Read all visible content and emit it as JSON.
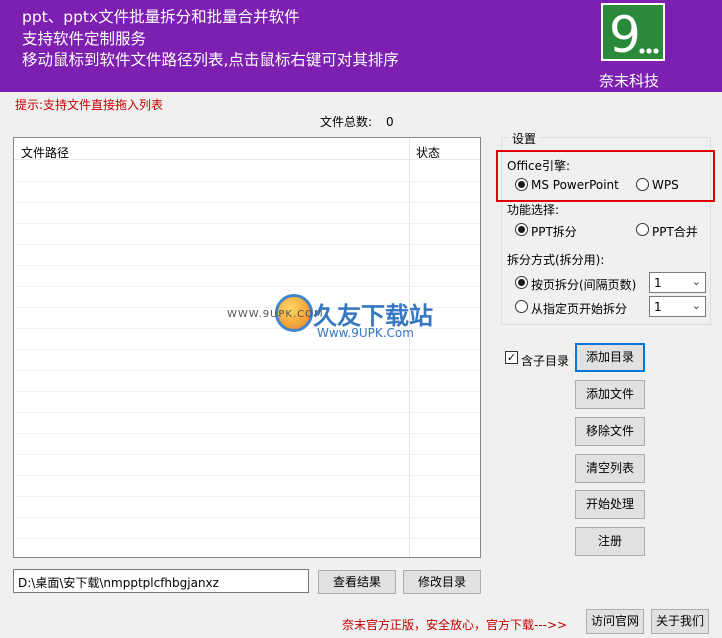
{
  "banner": {
    "lines": [
      "ppt、pptx文件批量拆分和批量合并软件",
      "支持软件定制服务",
      "移动鼠标到软件文件路径列表,点击鼠标右键可对其排序"
    ],
    "brand": "奈末科技",
    "logo_icon": "nemo-9-logo",
    "colors": {
      "banner": "#7d1fb1",
      "logo": "#2a8a3a",
      "highlight": "#e00000"
    }
  },
  "hint": "提示:支持文件直接拖入列表",
  "file_count": {
    "label": "文件总数:",
    "value": "0"
  },
  "file_list": {
    "columns": [
      "文件路径",
      "状态"
    ],
    "rows": []
  },
  "watermark": {
    "small": "WWW.9UPK.COM",
    "big": "久友下载站",
    "url": "Www.9UPK.Com"
  },
  "settings": {
    "legend": "设置",
    "engine": {
      "label": "Office引擎:",
      "options": [
        "MS PowerPoint",
        "WPS"
      ],
      "selected": "MS PowerPoint"
    },
    "function": {
      "label": "功能选择:",
      "options": [
        "PPT拆分",
        "PPT合并"
      ],
      "selected": "PPT拆分"
    },
    "split_mode": {
      "label": "拆分方式(拆分用):",
      "options": [
        {
          "label": "按页拆分(间隔页数)",
          "value": "1"
        },
        {
          "label": "从指定页开始拆分",
          "value": "1"
        }
      ],
      "selected": "按页拆分(间隔页数)"
    }
  },
  "include_subdirs": {
    "label": "含子目录",
    "checked": true
  },
  "buttons": {
    "add_dir": "添加目录",
    "add_file": "添加文件",
    "remove_file": "移除文件",
    "clear_list": "清空列表",
    "start": "开始处理",
    "register": "注册",
    "view_result": "查看结果",
    "modify_dir": "修改目录",
    "visit_site": "访问官网",
    "about": "关于我们"
  },
  "output_path": "D:\\桌面\\安下载\\nmpptplcfhbgjanxz",
  "footer_note": "奈末官方正版，安全放心，官方下载--->>"
}
